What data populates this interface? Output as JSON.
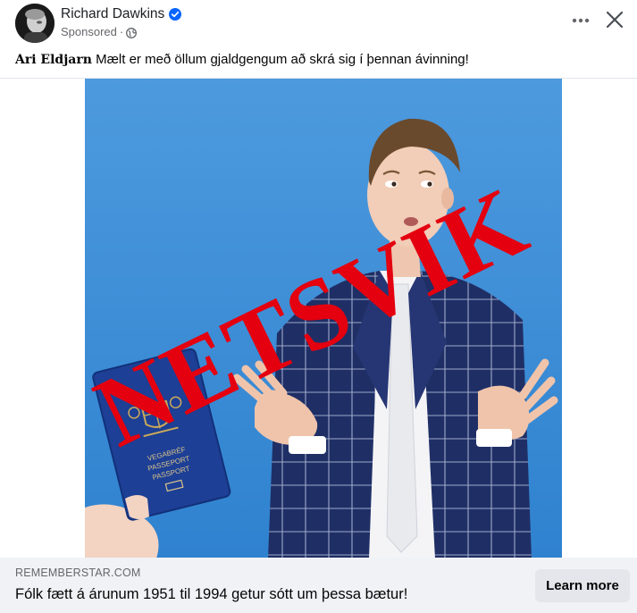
{
  "post": {
    "page_name": "Richard Dawkins",
    "sponsored_label": "Sponsored",
    "meta_separator": "·",
    "caption_author": "Ari Eldjarn",
    "caption_text": "Mælt er með öllum gjaldgengum að skrá sig í þennan ávinning!",
    "verified_icon": "verified-badge-icon",
    "audience_icon": "globe-icon"
  },
  "image": {
    "overlay_stamp": "NETSVIK",
    "passport_lines": [
      "VEGABRÉF",
      "PASSEPORT",
      "PASSPORT"
    ],
    "stamp_color": "#e4000f",
    "background_color": "#3f8fd6"
  },
  "link": {
    "domain": "REMEMBERSTAR.COM",
    "headline": "Fólk fætt á árunum 1951 til 1994 getur sótt um þessa bætur!",
    "cta_label": "Learn more"
  },
  "colors": {
    "accent_blue": "#0866ff",
    "link_bar_bg": "#f0f2f5",
    "button_bg": "#e4e6eb"
  }
}
